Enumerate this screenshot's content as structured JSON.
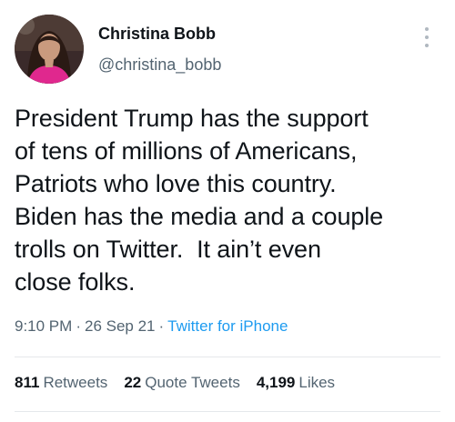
{
  "author": {
    "display_name": "Christina Bobb",
    "handle": "@christina_bobb",
    "avatar_icon": "profile-photo"
  },
  "tweet": {
    "text": "President Trump has the support\nof tens of millions of Americans,\nPatriots who love this country.\nBiden has the media and a couple\ntrolls on Twitter.  It ain’t even\nclose folks.",
    "time": "9:10 PM",
    "separator": "·",
    "date": "26 Sep 21",
    "source": "Twitter for iPhone"
  },
  "stats": {
    "retweets": {
      "count": "811",
      "label": "Retweets"
    },
    "quote_tweets": {
      "count": "22",
      "label": "Quote Tweets"
    },
    "likes": {
      "count": "4,199",
      "label": "Likes"
    }
  },
  "colors": {
    "text": "#0f1419",
    "secondary": "#536471",
    "link": "#1d9bf0",
    "divider": "#e5e8eb"
  },
  "icons": {
    "more": "more-vertical-icon"
  }
}
